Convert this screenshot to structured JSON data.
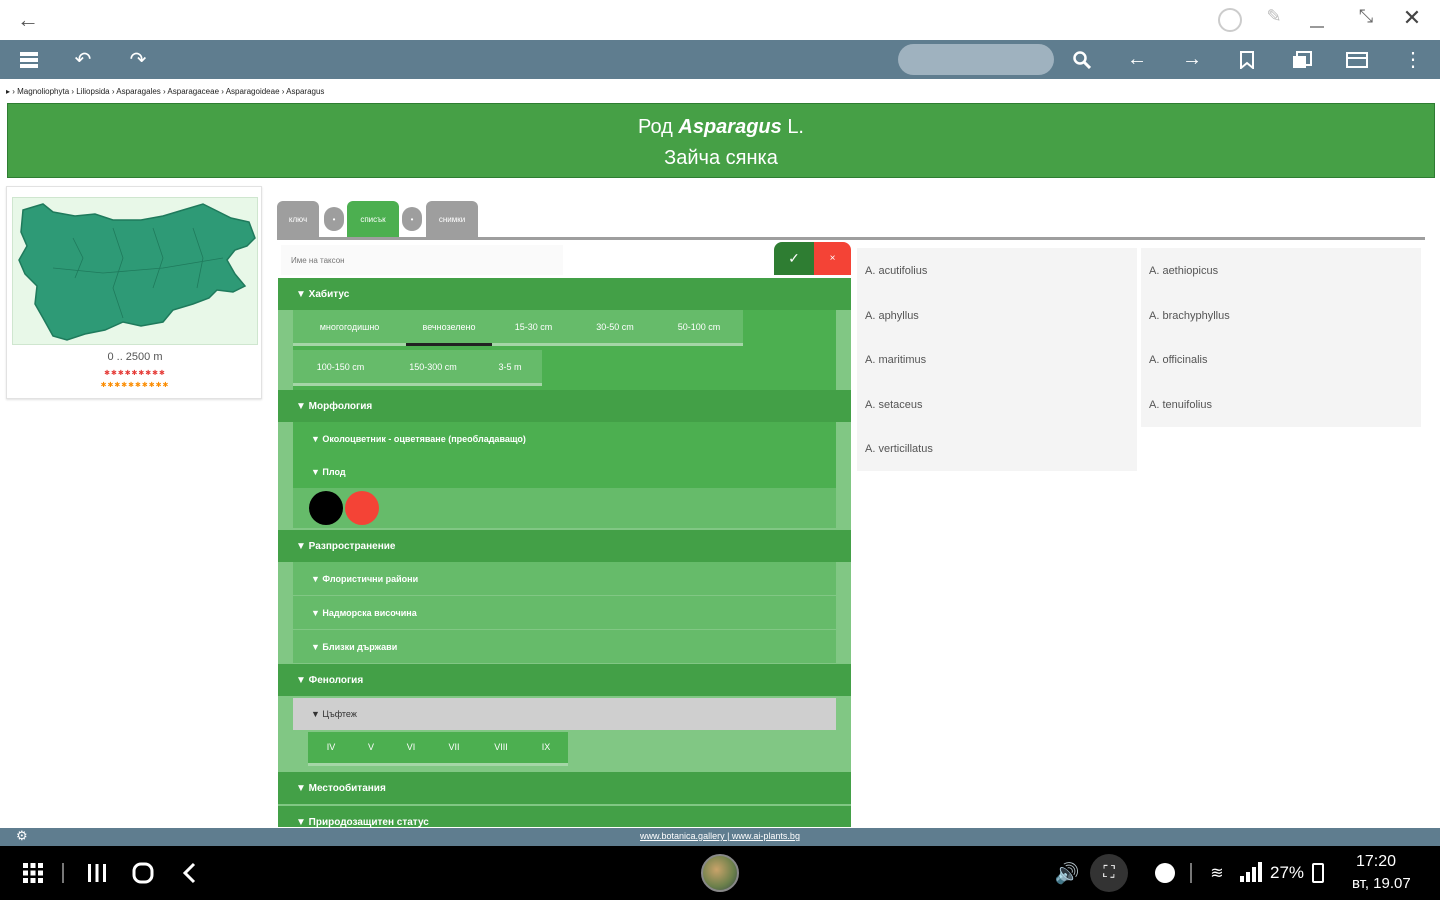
{
  "breadcrumb": "▸ › Magnoliophyta › Liliopsida › Asparagales › Asparagaceae › Asparagoideae › Asparagus",
  "header": {
    "rank": "Род",
    "genus": "Asparagus",
    "author": "L.",
    "common_name": "Зайча сянка"
  },
  "map": {
    "altitude": "0 .. 2500 m",
    "stars_red": "✱✱✱✱✱✱✱✱✱",
    "stars_orange": "✱✱✱✱✱✱✱✱✱✱"
  },
  "tabs": [
    {
      "label": "ключ"
    },
    {
      "label": "•"
    },
    {
      "label": "списък"
    },
    {
      "label": "•"
    },
    {
      "label": "снимки"
    }
  ],
  "filter": {
    "name_placeholder": "Име на таксон",
    "ok": "✓",
    "cancel": "×"
  },
  "sections": {
    "habit": "▼ Хабитус",
    "morphology": "▼ Морфология",
    "perianth": "▼ Околоцветник - оцветяване (преобладаващо)",
    "fruit": "▼ Плод",
    "distribution": "▼ Разпространение",
    "floristic": "▼ Флористични райони",
    "altitude": "▼ Надморска височина",
    "neighbors": "▼ Близки държави",
    "phenology": "▼ Фенология",
    "flowering": "▼ Цъфтеж",
    "habitat": "▼ Местообитания",
    "conservation": "▼ Природозащитен статус"
  },
  "habit_chips": [
    "многогодишно",
    "вечнозелено",
    "15-30 cm",
    "30-50 cm",
    "50-100 cm",
    "100-150 cm",
    "150-300 cm",
    "3-5 m"
  ],
  "fruit_colors": [
    "#000000",
    "#f44336"
  ],
  "months": [
    "IV",
    "V",
    "VI",
    "VII",
    "VIII",
    "IX"
  ],
  "species": [
    "A. acutifolius",
    "A. aethiopicus",
    "A. aphyllus",
    "A. brachyphyllus",
    "A. maritimus",
    "A. officinalis",
    "A. setaceus",
    "A. tenuifolius",
    "A. verticillatus"
  ],
  "footer": {
    "links": "www.botanica.gallery | www.ai-plants.bg"
  },
  "statusbar": {
    "battery": "27%",
    "time": "17:20",
    "date": "вт, 19.07"
  },
  "colors": {
    "toolbar": "#5f7d8f",
    "header_green": "#46a046",
    "panel_green": "#81c784",
    "section_green": "#43a047",
    "cancel_red": "#f44336"
  }
}
